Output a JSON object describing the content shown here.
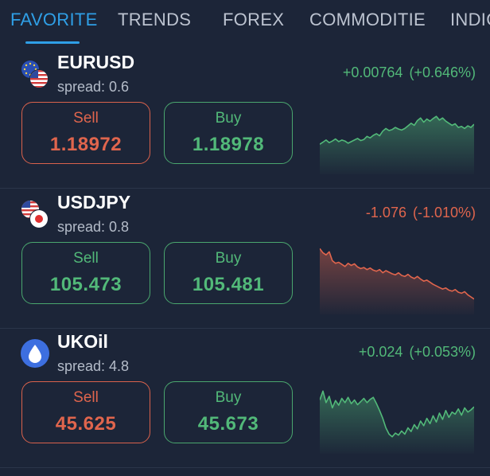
{
  "tabs": [
    {
      "label": "FAVORITE",
      "active": true
    },
    {
      "label": "TRENDS",
      "active": false
    },
    {
      "label": "FOREX",
      "active": false
    },
    {
      "label": "COMMODITIE",
      "active": false
    },
    {
      "label": "INDIC",
      "active": false
    }
  ],
  "colors": {
    "background": "#1c2538",
    "accent": "#2f9fe6",
    "up": "#52b979",
    "down": "#e0654d",
    "divider": "#2b3549"
  },
  "instruments": [
    {
      "symbol": "EURUSD",
      "icon": "eur-usd-flags-icon",
      "spread_text": "spread: 0.6",
      "change_abs": "+0.00764",
      "change_pct": "(+0.646%)",
      "direction": "up",
      "sell": {
        "label": "Sell",
        "price": "1.18972",
        "direction": "down"
      },
      "buy": {
        "label": "Buy",
        "price": "1.18978",
        "direction": "up"
      },
      "sparkline": [
        0.3,
        0.34,
        0.38,
        0.33,
        0.36,
        0.4,
        0.35,
        0.38,
        0.36,
        0.32,
        0.35,
        0.38,
        0.41,
        0.37,
        0.39,
        0.45,
        0.42,
        0.47,
        0.5,
        0.46,
        0.55,
        0.6,
        0.56,
        0.58,
        0.62,
        0.59,
        0.57,
        0.6,
        0.65,
        0.7,
        0.66,
        0.75,
        0.8,
        0.72,
        0.78,
        0.74,
        0.79,
        0.83,
        0.76,
        0.8,
        0.74,
        0.7,
        0.66,
        0.69,
        0.62,
        0.64,
        0.6,
        0.65,
        0.62,
        0.68
      ]
    },
    {
      "symbol": "USDJPY",
      "icon": "usd-jpy-flags-icon",
      "spread_text": "spread: 0.8",
      "change_abs": "-1.076",
      "change_pct": "(-1.010%)",
      "direction": "down",
      "sell": {
        "label": "Sell",
        "price": "105.473",
        "direction": "up"
      },
      "buy": {
        "label": "Buy",
        "price": "105.481",
        "direction": "up"
      },
      "sparkline": [
        0.98,
        0.9,
        0.86,
        0.92,
        0.75,
        0.7,
        0.72,
        0.68,
        0.64,
        0.7,
        0.66,
        0.69,
        0.63,
        0.6,
        0.62,
        0.58,
        0.61,
        0.57,
        0.55,
        0.58,
        0.52,
        0.56,
        0.53,
        0.5,
        0.48,
        0.52,
        0.47,
        0.45,
        0.49,
        0.44,
        0.41,
        0.45,
        0.4,
        0.36,
        0.38,
        0.34,
        0.3,
        0.27,
        0.24,
        0.21,
        0.23,
        0.19,
        0.17,
        0.2,
        0.15,
        0.13,
        0.16,
        0.1,
        0.06,
        0.02
      ]
    },
    {
      "symbol": "UKOil",
      "icon": "water-drop-icon",
      "spread_text": "spread: 4.8",
      "change_abs": "+0.024",
      "change_pct": "(+0.053%)",
      "direction": "up",
      "sell": {
        "label": "Sell",
        "price": "45.625",
        "direction": "down"
      },
      "buy": {
        "label": "Buy",
        "price": "45.673",
        "direction": "up"
      },
      "sparkline": [
        0.75,
        0.92,
        0.7,
        0.82,
        0.6,
        0.74,
        0.65,
        0.78,
        0.7,
        0.8,
        0.68,
        0.75,
        0.66,
        0.72,
        0.78,
        0.7,
        0.76,
        0.8,
        0.68,
        0.55,
        0.4,
        0.22,
        0.1,
        0.05,
        0.12,
        0.08,
        0.16,
        0.1,
        0.22,
        0.15,
        0.28,
        0.2,
        0.35,
        0.26,
        0.4,
        0.3,
        0.45,
        0.33,
        0.5,
        0.38,
        0.55,
        0.42,
        0.52,
        0.48,
        0.58,
        0.46,
        0.6,
        0.52,
        0.56,
        0.62
      ]
    }
  ]
}
